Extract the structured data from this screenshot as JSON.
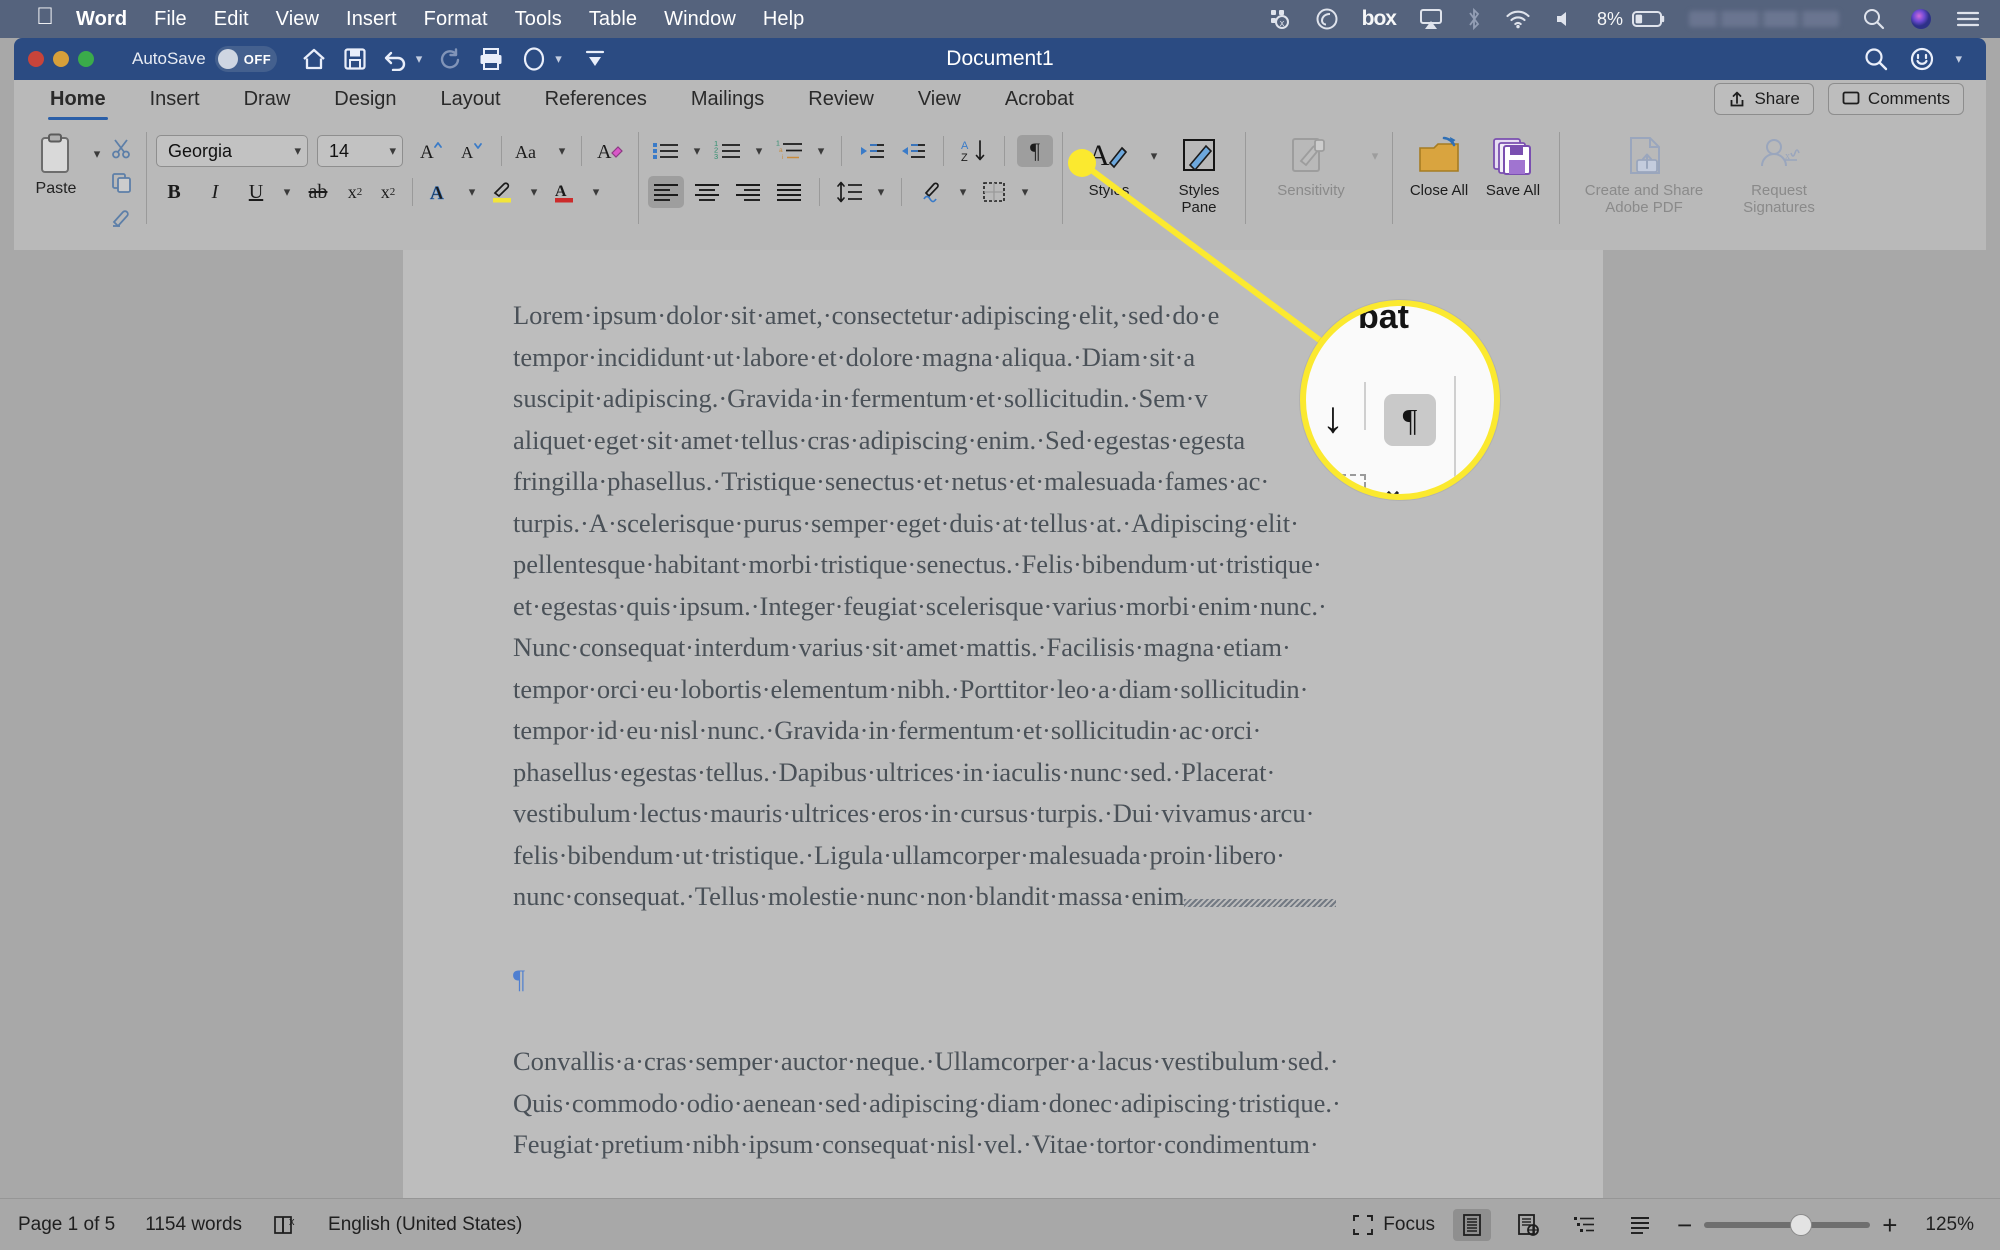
{
  "macos_menubar": {
    "apple_icon": "apple-icon",
    "items": [
      {
        "label": "Word",
        "bold": true
      },
      {
        "label": "File",
        "bold": false
      },
      {
        "label": "Edit",
        "bold": false
      },
      {
        "label": "View",
        "bold": false
      },
      {
        "label": "Insert",
        "bold": false
      },
      {
        "label": "Format",
        "bold": false
      },
      {
        "label": "Tools",
        "bold": false
      },
      {
        "label": "Table",
        "bold": false
      },
      {
        "label": "Window",
        "bold": false
      },
      {
        "label": "Help",
        "bold": false
      }
    ],
    "status_icons": [
      "dropbox-icon",
      "creative-cloud-icon",
      "box-icon",
      "airplay-icon",
      "bluetooth-icon",
      "wifi-icon",
      "volume-icon"
    ],
    "box_label": "box",
    "battery_percent": "8%",
    "right_icons": [
      "spotlight-search-icon",
      "siri-icon",
      "control-center-icon"
    ]
  },
  "titlebar": {
    "autosave_label": "AutoSave",
    "autosave_state": "OFF",
    "document_title": "Document1",
    "quick_access": [
      "home-icon",
      "save-icon",
      "undo-icon",
      "redo-icon",
      "print-icon",
      "format-circle-icon",
      "customize-qat-icon"
    ],
    "right_icons": [
      "search-icon",
      "account-smiley-icon"
    ]
  },
  "ribbon": {
    "tabs": [
      {
        "label": "Home",
        "active": true
      },
      {
        "label": "Insert",
        "active": false
      },
      {
        "label": "Draw",
        "active": false
      },
      {
        "label": "Design",
        "active": false
      },
      {
        "label": "Layout",
        "active": false
      },
      {
        "label": "References",
        "active": false
      },
      {
        "label": "Mailings",
        "active": false
      },
      {
        "label": "Review",
        "active": false
      },
      {
        "label": "View",
        "active": false
      },
      {
        "label": "Acrobat",
        "active": false
      }
    ],
    "share_label": "Share",
    "comments_label": "Comments",
    "clipboard": {
      "paste_label": "Paste",
      "cut_icon": "scissors-icon",
      "copy_icon": "copy-icon",
      "format_painter_icon": "format-painter-icon"
    },
    "font": {
      "family_value": "Georgia",
      "size_value": "14",
      "grow_font_icon": "grow-font-icon",
      "shrink_font_icon": "shrink-font-icon",
      "change_case_icon": "change-case-icon",
      "clear_formatting_icon": "clear-formatting-icon",
      "bold_icon": "bold-icon",
      "italic_icon": "italic-icon",
      "underline_icon": "underline-icon",
      "strikethrough_icon": "strikethrough-icon",
      "subscript_icon": "subscript-icon",
      "superscript_icon": "superscript-icon",
      "text_effects_icon": "text-effects-icon",
      "highlight_icon": "highlight-color-icon",
      "font_color_icon": "font-color-icon"
    },
    "paragraph": {
      "bullets_icon": "bullets-icon",
      "numbering_icon": "numbering-icon",
      "multilevel_icon": "multilevel-list-icon",
      "decrease_indent_icon": "decrease-indent-icon",
      "increase_indent_icon": "increase-indent-icon",
      "sort_icon": "sort-az-icon",
      "show_marks_icon": "show-formatting-marks-icon",
      "show_marks_active": true,
      "align_left_icon": "align-left-icon",
      "align_center_icon": "align-center-icon",
      "align_right_icon": "align-right-icon",
      "justify_icon": "justify-icon",
      "line_spacing_icon": "line-spacing-icon",
      "shading_icon": "shading-icon",
      "borders_icon": "borders-icon"
    },
    "styles": [
      {
        "label": "Styles",
        "icon": "styles-icon",
        "dim": false
      },
      {
        "label": "Styles Pane",
        "icon": "styles-pane-icon",
        "dim": false
      }
    ],
    "sensitivity": {
      "label": "Sensitivity",
      "icon": "sensitivity-icon",
      "dim": true
    },
    "file_actions": [
      {
        "label": "Close All",
        "icon": "close-all-folder-icon",
        "dim": false
      },
      {
        "label": "Save All",
        "icon": "save-all-icon",
        "dim": false
      }
    ],
    "acrobat_actions": [
      {
        "label": "Create and Share Adobe PDF",
        "icon": "create-share-pdf-icon",
        "dim": true
      },
      {
        "label": "Request Signatures",
        "icon": "request-signatures-icon",
        "dim": true
      }
    ]
  },
  "document": {
    "paragraph_1": "Lorem·ipsum·dolor·sit·amet,·consectetur·adipiscing·elit,·sed·do·e tempor·incididunt·ut·labore·et·dolore·magna·aliqua.·Diam·sit·a suscipit·adipiscing.·Gravida·in·fermentum·et·sollicitudin.·Sem·v aliquet·eget·sit·amet·tellus·cras·adipiscing·enim.·Sed·egestas·egesta fringilla·phasellus.·Tristique·senectus·et·netus·et·malesuada·fames·ac· turpis.·A·scelerisque·purus·semper·eget·duis·at·tellus·at.·Adipiscing·elit· pellentesque·habitant·morbi·tristique·senectus.·Felis·bibendum·ut·tristique· et·egestas·quis·ipsum.·Integer·feugiat·scelerisque·varius·morbi·enim·nunc.· Nunc·consequat·interdum·varius·sit·amet·mattis.·Facilisis·magna·etiam· tempor·orci·eu·lobortis·elementum·nibh.·Porttitor·leo·a·diam·sollicitudin· tempor·id·eu·nisl·nunc.·Gravida·in·fermentum·et·sollicitudin·ac·orci· phasellus·egestas·tellus.·Dapibus·ultrices·in·iaculis·nunc·sed.·Placerat· vestibulum·lectus·mauris·ultrices·eros·in·cursus·turpis.·Dui·vivamus·arcu· felis·bibendum·ut·tristique.·Ligula·ullamcorper·malesuada·proin·libero· nunc·consequat.·Tellus·molestie·nunc·non·blandit·massa·enim",
    "lines": [
      "Lorem·ipsum·dolor·sit·amet,·consectetur·adipiscing·elit,·sed·do·e",
      "tempor·incididunt·ut·labore·et·dolore·magna·aliqua.·Diam·sit·a",
      "suscipit·adipiscing.·Gravida·in·fermentum·et·sollicitudin.·Sem·v",
      "aliquet·eget·sit·amet·tellus·cras·adipiscing·enim.·Sed·egestas·egesta",
      "fringilla·phasellus.·Tristique·senectus·et·netus·et·malesuada·fames·ac·",
      "turpis.·A·scelerisque·purus·semper·eget·duis·at·tellus·at.·Adipiscing·elit·",
      "pellentesque·habitant·morbi·tristique·senectus.·Felis·bibendum·ut·tristique·",
      "et·egestas·quis·ipsum.·Integer·feugiat·scelerisque·varius·morbi·enim·nunc.·",
      "Nunc·consequat·interdum·varius·sit·amet·mattis.·Facilisis·magna·etiam·",
      "tempor·orci·eu·lobortis·elementum·nibh.·Porttitor·leo·a·diam·sollicitudin·",
      "tempor·id·eu·nisl·nunc.·Gravida·in·fermentum·et·sollicitudin·ac·orci·",
      "phasellus·egestas·tellus.·Dapibus·ultrices·in·iaculis·nunc·sed.·Placerat·",
      "vestibulum·lectus·mauris·ultrices·eros·in·cursus·turpis.·Dui·vivamus·arcu·",
      "felis·bibendum·ut·tristique.·Ligula·ullamcorper·malesuada·proin·libero·",
      "nunc·consequat.·Tellus·molestie·nunc·non·blandit·massa·enim"
    ],
    "empty_paragraph_mark": "¶",
    "lines_2": [
      "Convallis·a·cras·semper·auctor·neque.·Ullamcorper·a·lacus·vestibulum·sed.·",
      "Quis·commodo·odio·aenean·sed·adipiscing·diam·donec·adipiscing·tristique.·",
      "Feugiat·pretium·nibh·ipsum·consequat·nisl·vel.·Vitae·tortor·condimentum·"
    ]
  },
  "callout": {
    "magnifier_acrobat_text": "bat",
    "magnifier_pilcrow": "¶",
    "magnifier_arrow": "↓",
    "magnifier_chevron": "⌄",
    "highlight_color": "#fbe92f"
  },
  "statusbar": {
    "page_indicator": "Page 1 of 5",
    "word_count": "1154 words",
    "proofing_icon": "proofing-errors-icon",
    "language": "English (United States)",
    "focus_label": "Focus",
    "view_icons": [
      "print-layout-icon",
      "web-layout-icon",
      "outline-icon",
      "draft-icon"
    ],
    "zoom_out_icon": "zoom-out-icon",
    "zoom_in_icon": "zoom-in-icon",
    "zoom_level": "125%"
  }
}
